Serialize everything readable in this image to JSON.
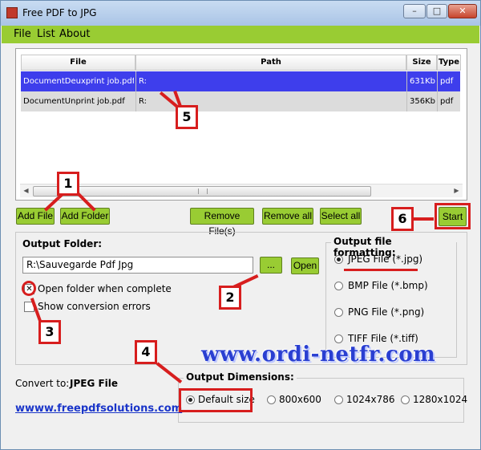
{
  "window": {
    "title": "Free PDF to JPG"
  },
  "menu": [
    "File",
    "List",
    "About"
  ],
  "table": {
    "columns": [
      "File",
      "Path",
      "Size",
      "Type"
    ],
    "rows": [
      {
        "file": "DocumentDeuxprint job.pdf",
        "path": "R:",
        "size": "631Kb",
        "type": "pdf"
      },
      {
        "file": "DocumentUnprint job.pdf",
        "path": "R:",
        "size": "356Kb",
        "type": "pdf"
      }
    ]
  },
  "buttons": {
    "add_file": "Add File",
    "add_folder": "Add Folder",
    "remove_files": "Remove File(s)",
    "remove_all": "Remove all",
    "select_all": "Select all",
    "start": "Start",
    "browse": "...",
    "open": "Open"
  },
  "output": {
    "label": "Output Folder:",
    "folder": "R:\\Sauvegarde Pdf Jpg",
    "open_when_complete": "Open folder when complete",
    "show_errors": "Show conversion errors"
  },
  "formatting": {
    "title": "Output file formatting:",
    "options": [
      "JPEG File (*.jpg)",
      "BMP File (*.bmp)",
      "PNG File (*.png)",
      "TIFF File (*.tiff)"
    ],
    "selected": "JPEG File (*.jpg)"
  },
  "convert_to": {
    "label": "Convert to:",
    "value": "JPEG File"
  },
  "dimensions": {
    "title": "Output Dimensions:",
    "options": [
      "Default size",
      "800x600",
      "1024x786",
      "1280x1024"
    ],
    "selected": "Default size"
  },
  "link": "wwww.freepdfsolutions.com",
  "watermark": "www.ordi-netfr.com",
  "annotations": [
    "1",
    "2",
    "3",
    "4",
    "5",
    "6"
  ],
  "colors": {
    "accent_green": "#99cc33",
    "selection_blue": "#3e3eec",
    "annotation_red": "#d71e1e"
  }
}
